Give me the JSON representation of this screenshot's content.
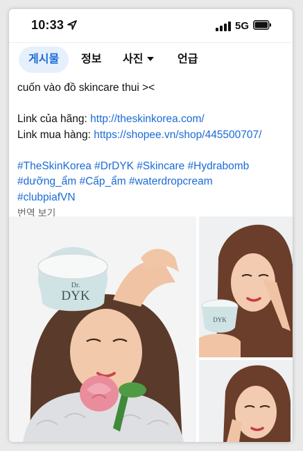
{
  "status_bar": {
    "time": "10:33",
    "network": "5G"
  },
  "tabs": [
    {
      "label": "게시물",
      "active": true
    },
    {
      "label": "정보",
      "active": false
    },
    {
      "label": "사진",
      "active": false,
      "has_dropdown": true
    },
    {
      "label": "언급",
      "active": false
    }
  ],
  "post": {
    "caption": "cuốn vào đồ skincare thui ><",
    "brand_link_label": "Link của hãng: ",
    "brand_link_url": "http://theskinkorea.com/",
    "shop_link_label": "Link mua hàng: ",
    "shop_link_url": "https://shopee.vn/shop/445500707/",
    "hashtags_line1": "#TheSkinKorea #DrDYK #Skincare #Hydrabomb",
    "hashtags_line2": "#dưỡng_ẩm #Cấp_ẩm #waterdropcream",
    "hashtags_line3": "#clubpiafVN",
    "translate_label": "번역 보기"
  },
  "photos": {
    "jar_brand_small": "Dr.",
    "jar_brand_large": "DYK",
    "count": 3
  },
  "colors": {
    "accent": "#1a6bd6",
    "active_tab_bg": "#e6f0fd",
    "muted_text": "#65676b"
  },
  "icons": [
    "location-arrow-icon",
    "signal-icon",
    "battery-icon",
    "chevron-down-icon"
  ]
}
